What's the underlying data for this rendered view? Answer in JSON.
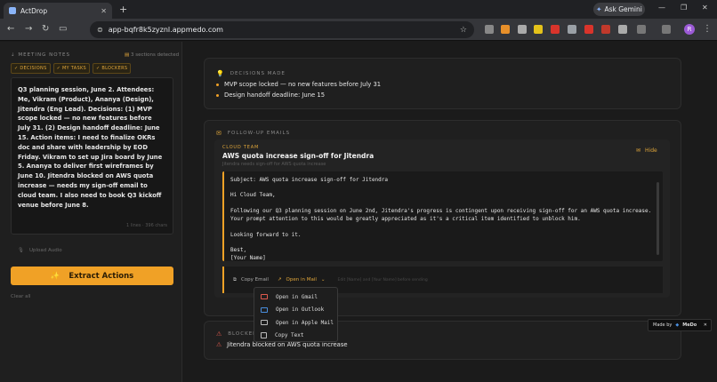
{
  "browser": {
    "tab_title": "ActDrop",
    "new_tab": "+",
    "url": "app-bqfr8k5zyznl.appmedo.com",
    "gemini_label": "Ask Gemini",
    "profile_initial": "R"
  },
  "left": {
    "section_label": "MEETING NOTES",
    "detected": "3 sections detected",
    "chips": [
      "✓ DECISIONS",
      "✓ MY TASKS",
      "✓ BLOCKERS"
    ],
    "notes_text": "Q3 planning session, June 2. Attendees: Me, Vikram (Product), Ananya (Design), Jitendra (Eng Lead). Decisions: (1) MVP scope locked — no new features before July 31. (2) Design handoff deadline: June 15. Action items: I need to finalize OKRs doc and share with leadership by EOD Friday. Vikram to set up Jira board by June 5. Ananya to deliver first wireframes by June 10. Jitendra blocked on AWS quota increase — needs my sign-off email to cloud team. I also need to book Q3 kickoff venue before June 8.",
    "count": "1 lines · 396 chars",
    "upload_label": "Upload Audio",
    "extract_label": "Extract Actions",
    "clear_all": "Clear all"
  },
  "decisions": {
    "label": "DECISIONS MADE",
    "items": [
      "MVP scope locked — no new features before July 31",
      "Design handoff deadline: June 15"
    ]
  },
  "followup": {
    "label": "FOLLOW-UP EMAILS",
    "team": "CLOUD TEAM",
    "title": "AWS quota increase sign-off for Jitendra",
    "subtitle": "Jitendra needs sign-off for AWS quota increase",
    "hide_label": "Hide",
    "body": {
      "subject": "Subject: AWS quota increase sign-off for Jitendra",
      "greeting": "Hi Cloud Team,",
      "para1": "Following our Q3 planning session on June 2nd, Jitendra's progress is contingent upon receiving sign-off for an AWS quota increase. Your prompt attention to this would be greatly appreciated as it's a critical item identified to unblock him.",
      "para2": "Looking forward to it.",
      "sign1": "Best,",
      "sign2": "[Your Name]"
    },
    "copy_email": "Copy Email",
    "open_in_mail": "Open in Mail",
    "hint": "Edit [Name] and [Your Name] before sending"
  },
  "menu": {
    "items": [
      "Open in Gmail",
      "Open in Outlook",
      "Open in Apple Mail",
      "Copy Text"
    ]
  },
  "blockers": {
    "label": "BLOCKERS",
    "items": [
      "Jitendra blocked on AWS quota increase"
    ]
  },
  "made_by": {
    "label": "Made by",
    "brand": "MeDo"
  },
  "colors": {
    "accent": "#f0a126",
    "danger": "#e05a4e",
    "panel": "#1f1f1f"
  }
}
